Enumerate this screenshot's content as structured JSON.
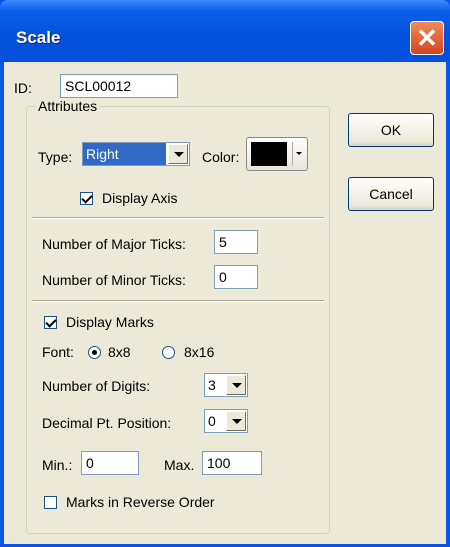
{
  "window": {
    "title": "Scale"
  },
  "id_field": {
    "label": "ID:",
    "value": "SCL00012"
  },
  "attributes": {
    "group_label": "Attributes",
    "type": {
      "label": "Type:",
      "value": "Right"
    },
    "color": {
      "label": "Color:",
      "value": "#000000"
    },
    "display_axis": {
      "label": "Display Axis",
      "checked": true
    }
  },
  "ticks": {
    "major": {
      "label": "Number of Major Ticks:",
      "value": "5"
    },
    "minor": {
      "label": "Number of Minor Ticks:",
      "value": "0"
    }
  },
  "marks": {
    "display_marks": {
      "label": "Display Marks",
      "checked": true
    },
    "font": {
      "label": "Font:",
      "options": [
        "8x8",
        "8x16"
      ],
      "selected": "8x8"
    },
    "digits": {
      "label": "Number of Digits:",
      "value": "3"
    },
    "decimal": {
      "label": "Decimal Pt. Position:",
      "value": "0"
    },
    "min": {
      "label": "Min.:",
      "value": "0"
    },
    "max": {
      "label": "Max.",
      "value": "100"
    },
    "reverse": {
      "label": "Marks in Reverse Order",
      "checked": false
    }
  },
  "buttons": {
    "ok": "OK",
    "cancel": "Cancel"
  }
}
